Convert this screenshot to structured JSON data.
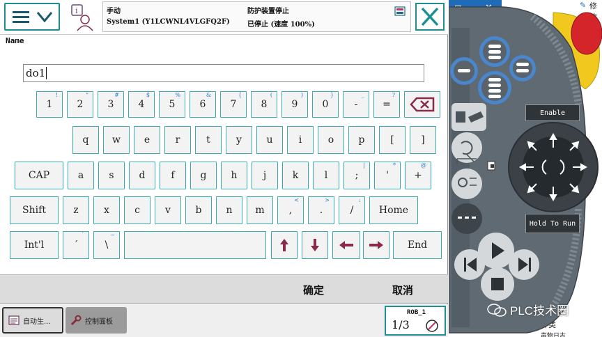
{
  "status": {
    "mode": "手动",
    "system": "System1 (Y1LCWNL4VLGFQ2F)",
    "safety": "防护装置停止",
    "state": "已停止 (速度 100%)"
  },
  "field": {
    "label": "Name",
    "value": "do1"
  },
  "keyboard": {
    "row1": [
      {
        "k": "1",
        "s": "!"
      },
      {
        "k": "2",
        "s": "\""
      },
      {
        "k": "3",
        "s": "#"
      },
      {
        "k": "4",
        "s": "$"
      },
      {
        "k": "5",
        "s": "%"
      },
      {
        "k": "6",
        "s": "&"
      },
      {
        "k": "7",
        "s": "{"
      },
      {
        "k": "8",
        "s": "("
      },
      {
        "k": "9",
        "s": ")"
      },
      {
        "k": "0",
        "s": "}"
      },
      {
        "k": "-",
        "s": "_"
      },
      {
        "k": "=",
        "s": "?"
      }
    ],
    "row2": [
      "q",
      "w",
      "e",
      "r",
      "t",
      "y",
      "u",
      "i",
      "o",
      "p",
      "[",
      "]"
    ],
    "row3_cap": "CAP",
    "row3": [
      {
        "k": "a",
        "s": ""
      },
      {
        "k": "s",
        "s": ""
      },
      {
        "k": "d",
        "s": ""
      },
      {
        "k": "f",
        "s": ""
      },
      {
        "k": "g",
        "s": ""
      },
      {
        "k": "h",
        "s": ""
      },
      {
        "k": "j",
        "s": ""
      },
      {
        "k": "k",
        "s": ""
      },
      {
        "k": "l",
        "s": ""
      },
      {
        "k": ";",
        "s": "|"
      },
      {
        "k": "'",
        "s": "*"
      },
      {
        "k": "+",
        "s": "@"
      }
    ],
    "row4_shift": "Shift",
    "row4": [
      {
        "k": "z",
        "s": ""
      },
      {
        "k": "x",
        "s": ""
      },
      {
        "k": "c",
        "s": ""
      },
      {
        "k": "v",
        "s": ""
      },
      {
        "k": "b",
        "s": ""
      },
      {
        "k": "n",
        "s": ""
      },
      {
        "k": "m",
        "s": ""
      },
      {
        "k": ",",
        "s": "<"
      },
      {
        "k": ".",
        "s": ">"
      },
      {
        "k": "/",
        "s": ":"
      }
    ],
    "row4_home": "Home",
    "row5_intl": "Int'l",
    "row5_keys": [
      {
        "k": "´",
        "s": "`"
      },
      {
        "k": "\\",
        "s": "~"
      }
    ],
    "row5_end": "End"
  },
  "buttons": {
    "ok": "确定",
    "cancel": "取消"
  },
  "taskbar": {
    "tab1": "自动生...",
    "tab2": "控制面板",
    "rob": "ROB_1",
    "fraction": "1/3"
  },
  "pendant": {
    "enable": "Enable",
    "hold": "Hold To Run",
    "watermark": "PLC技术圈",
    "side_text1": "修改",
    "side_text2": "种类",
    "side_text3": "声物日志"
  },
  "colors": {
    "teal": "#1d8f94",
    "key_border": "#39a9ad",
    "pendant_grey": "#5f6a73",
    "pendant_blue": "#4a86cc",
    "yellow": "#f0c81e",
    "red": "#d3252a"
  }
}
